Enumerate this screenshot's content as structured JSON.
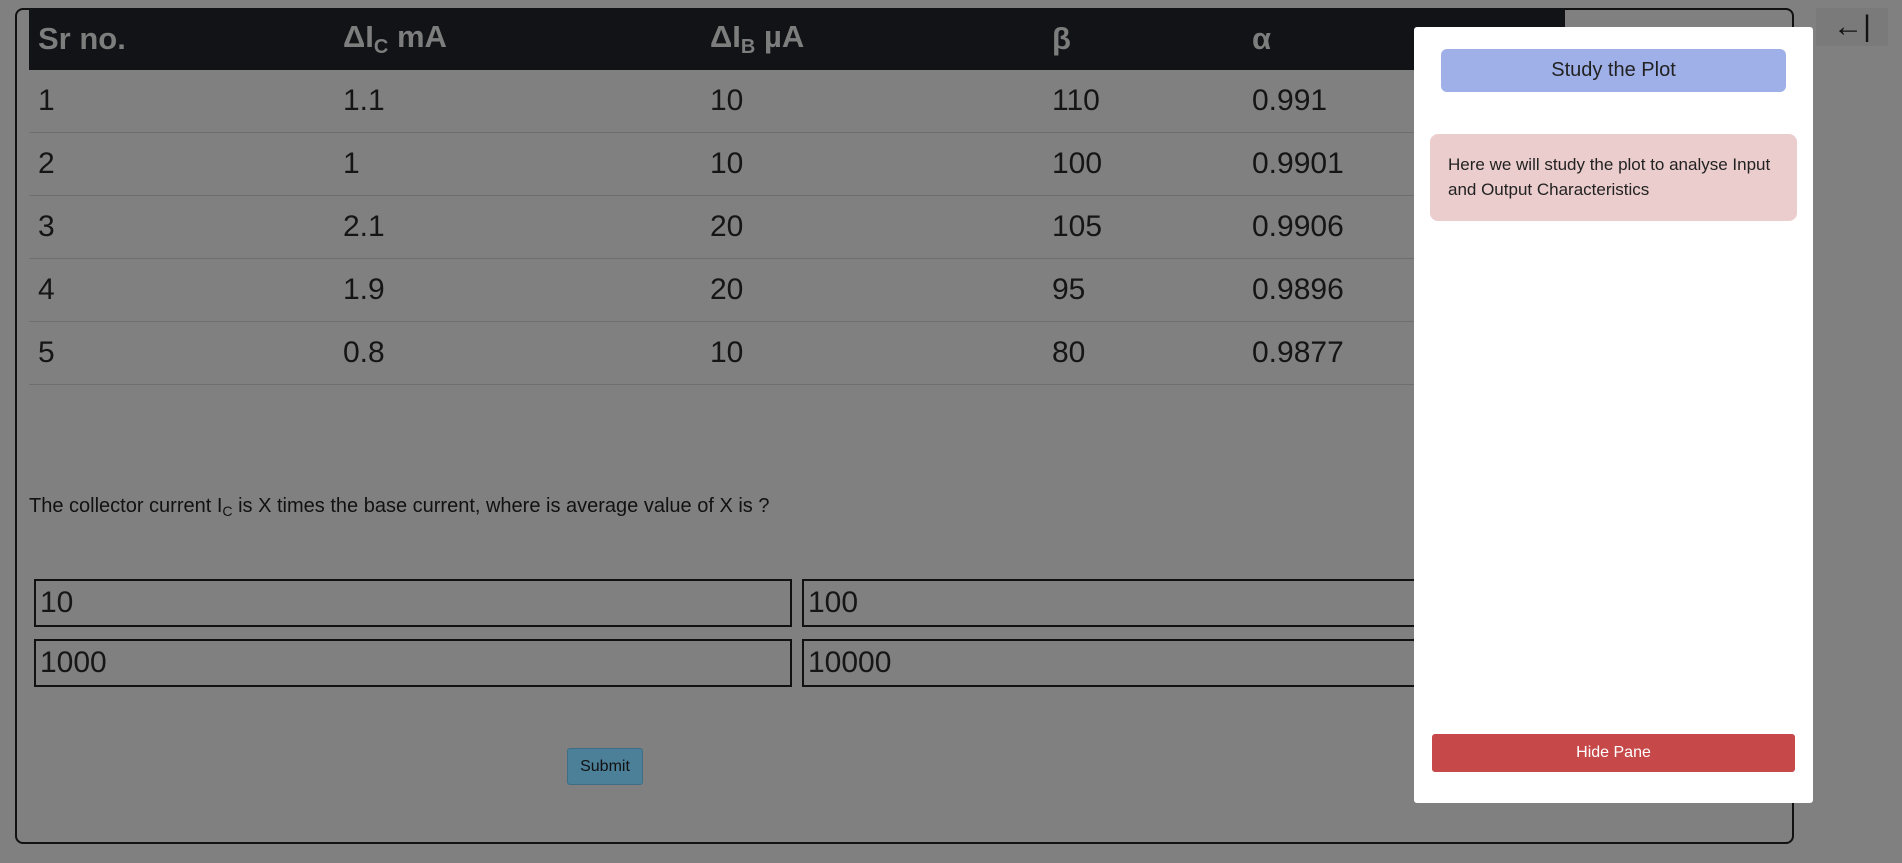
{
  "table": {
    "headers": {
      "sr": "Sr no.",
      "ic_main": "ΔI",
      "ic_sub": "C",
      "ic_unit": " mA",
      "ib_main": "ΔI",
      "ib_sub": "B",
      "ib_unit": " µA",
      "beta": "β",
      "alpha": "α"
    },
    "rows": [
      {
        "sr": "1",
        "ic": "1.1",
        "ib": "10",
        "beta": "110",
        "alpha": "0.991"
      },
      {
        "sr": "2",
        "ic": "1",
        "ib": "10",
        "beta": "100",
        "alpha": "0.9901"
      },
      {
        "sr": "3",
        "ic": "2.1",
        "ib": "20",
        "beta": "105",
        "alpha": "0.9906"
      },
      {
        "sr": "4",
        "ic": "1.9",
        "ib": "20",
        "beta": "95",
        "alpha": "0.9896"
      },
      {
        "sr": "5",
        "ic": "0.8",
        "ib": "10",
        "beta": "80",
        "alpha": "0.9877"
      }
    ]
  },
  "question": {
    "part1": "The collector current I",
    "sub": "C",
    "part2": " is X times the base current, where is average value of X is ?"
  },
  "options": [
    "10",
    "100",
    "1000",
    "10000"
  ],
  "submit_label": "Submit",
  "collapse_icon": "←|",
  "pane": {
    "title": "Study the Plot",
    "note": "Here we will study the plot to analyse Input and Output Characteristics",
    "hide_label": "Hide Pane"
  }
}
